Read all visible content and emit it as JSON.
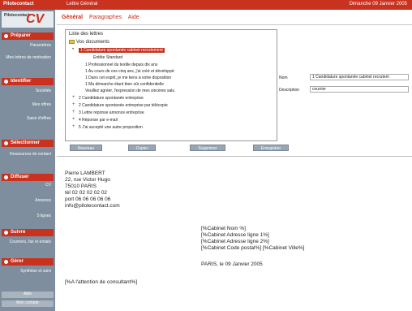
{
  "topbar": {
    "brand": "Pilotecontact",
    "tab": "Lettre Général",
    "date": "Dimanche 09 Janvier 2005"
  },
  "logo": {
    "small": "Pilotecontact",
    "cv": "CV"
  },
  "sidebar": {
    "sections": [
      {
        "label": "Préparer",
        "items": [
          "Paramètres",
          "Mes lettres de motivation"
        ]
      },
      {
        "label": "Identifier",
        "items": [
          "Sociétés",
          "Mes offres",
          "Saisir d'offres"
        ]
      },
      {
        "label": "Sélectionner",
        "items": [
          "Ressources de contact"
        ]
      },
      {
        "label": "Diffuser",
        "items": [
          "CV",
          "Annonce",
          "5 lignes"
        ]
      },
      {
        "label": "Suivre",
        "items": [
          "Courriers, fax et emails"
        ]
      },
      {
        "label": "Gérer",
        "items": [
          "Synthèse et suivi"
        ]
      }
    ],
    "footer": [
      "Aide",
      "Mon compte"
    ]
  },
  "menu": {
    "general": "Général",
    "paragraphs": "Paragraphes",
    "help": "Aide"
  },
  "panel": {
    "title": "Liste des lettres",
    "folder": "Vos documents",
    "selected": "1 Candidature spontanée cabinet recrutement",
    "sub_items": [
      "Entête Standard",
      "1 Professionnel du textile depuis dix ans",
      "1 Au cours de ces cinq ans, j'ai créé et développé",
      "1 Dans cet esprit, je me tiens à votre disposition",
      "1 Ma démarche étant bien sûr confidentielle",
      "Veuillez agréer, l'expression de mes sincères salu"
    ],
    "items": [
      "2 Candidature spontanée entreprise",
      "2 Candidature spontanée entreprise par télécopie",
      "3 Lettre réponse annonce entreprise",
      "4 Réponse par e-mail",
      "5 J'ai accepté une autre proposition"
    ]
  },
  "fields": {
    "name_label": "Nom",
    "name_value": "1 Candidature spontanée cabinet recrutem",
    "desc_label": "Description",
    "desc_value": "courrier"
  },
  "buttons": [
    "Nouveau",
    "Copier",
    "Supprimer",
    "Enregistrer"
  ],
  "letter": {
    "sender": [
      "Pierre LAMBERT",
      "22, rue Victor Hugo",
      "75010 PARIS",
      "tél    02 02 02 02 02",
      "port   06 06 06 06 06",
      "info@pilotecontact.com"
    ],
    "recipient": [
      "[%Cabinet Nom %]",
      "[%Cabinet Adresse ligne 1%]",
      "[%Cabinet Adresse ligne 2%]",
      "[%Cabinet Code postal%] [%Cabinet Ville%]"
    ],
    "date": "PARIS, le 09 Janvier 2005",
    "attention": "[%A l'attention de consultant%]"
  }
}
